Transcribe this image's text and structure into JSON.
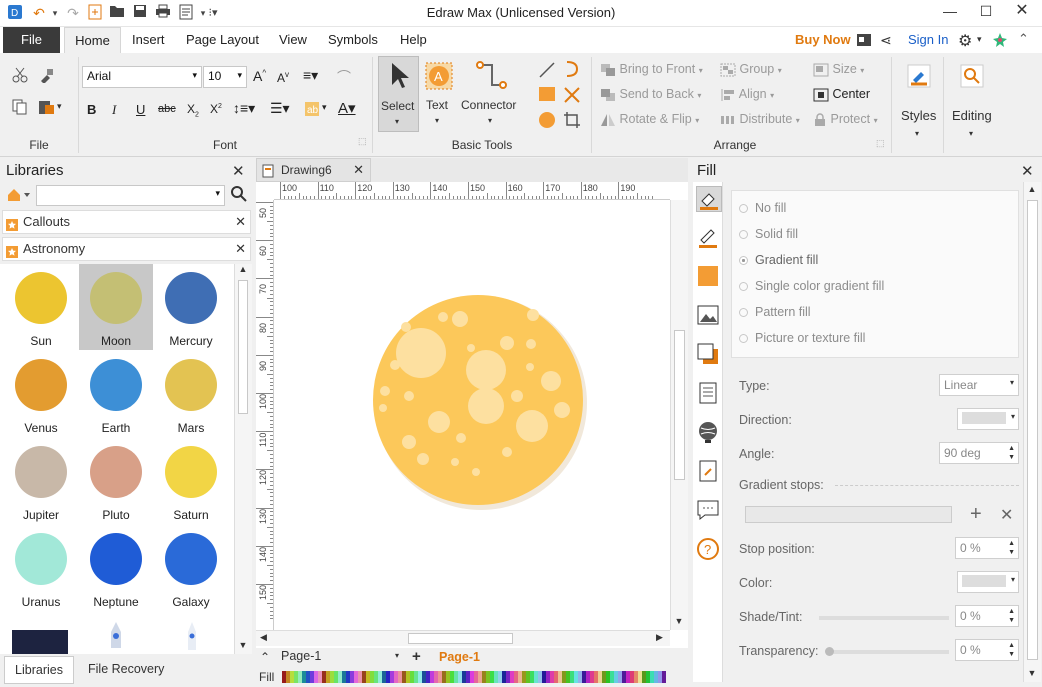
{
  "app": {
    "title": "Edraw Max (Unlicensed Version)"
  },
  "menu": {
    "tabs": [
      "File",
      "Home",
      "Insert",
      "Page Layout",
      "View",
      "Symbols",
      "Help"
    ],
    "buy_now": "Buy Now",
    "sign_in": "Sign In"
  },
  "ribbon": {
    "groups": {
      "file": "File",
      "font": "Font",
      "basic_tools": "Basic Tools",
      "arrange": "Arrange",
      "styles": "Styles",
      "editing": "Editing"
    },
    "font_name": "Arial",
    "font_size": "10",
    "tools": {
      "select": "Select",
      "text": "Text",
      "connector": "Connector"
    },
    "arrange": {
      "bring_to_front": "Bring to Front",
      "send_to_back": "Send to Back",
      "rotate_flip": "Rotate & Flip",
      "group": "Group",
      "align": "Align",
      "distribute": "Distribute",
      "size": "Size",
      "center": "Center",
      "protect": "Protect"
    }
  },
  "libraries": {
    "title": "Libraries",
    "categories": [
      "Callouts",
      "Astronomy"
    ],
    "shapes": [
      {
        "label": "Sun",
        "color": "#ecc530"
      },
      {
        "label": "Moon",
        "color": "#c4bf74"
      },
      {
        "label": "Mercury",
        "color": "#3f6eb4"
      },
      {
        "label": "Venus",
        "color": "#e39c30"
      },
      {
        "label": "Earth",
        "color": "#3d8fd6"
      },
      {
        "label": "Mars",
        "color": "#e3c352"
      },
      {
        "label": "Jupiter",
        "color": "#c8b8a8"
      },
      {
        "label": "Pluto",
        "color": "#d8a088"
      },
      {
        "label": "Saturn",
        "color": "#f2d545"
      },
      {
        "label": "Uranus",
        "color": "#a2e8d8"
      },
      {
        "label": "Neptune",
        "color": "#1f5cd6"
      },
      {
        "label": "Galaxy",
        "color": "#2a6ad8"
      }
    ],
    "bottom_tabs": [
      "Libraries",
      "File Recovery"
    ]
  },
  "document": {
    "tab": "Drawing6",
    "ruler_h": [
      "100",
      "110",
      "120",
      "130",
      "140",
      "150",
      "160",
      "170",
      "180",
      "190"
    ],
    "ruler_v": [
      "50",
      "60",
      "70",
      "80",
      "90",
      "100",
      "110",
      "120",
      "130",
      "140",
      "150"
    ],
    "page_select": "Page-1",
    "page_tab": "Page-1",
    "fill_label": "Fill",
    "moon_color": "#fcc85a"
  },
  "fill_panel": {
    "title": "Fill",
    "options": [
      "No fill",
      "Solid fill",
      "Gradient fill",
      "Single color gradient fill",
      "Pattern fill",
      "Picture or texture fill"
    ],
    "selected": "Gradient fill",
    "labels": {
      "type": "Type:",
      "direction": "Direction:",
      "angle": "Angle:",
      "gradient_stops": "Gradient stops:",
      "stop_position": "Stop position:",
      "color": "Color:",
      "shade_tint": "Shade/Tint:",
      "transparency": "Transparency:"
    },
    "values": {
      "type": "Linear",
      "angle": "90 deg",
      "stop_position": "0 %",
      "shade_tint": "0 %",
      "transparency": "0 %"
    }
  }
}
